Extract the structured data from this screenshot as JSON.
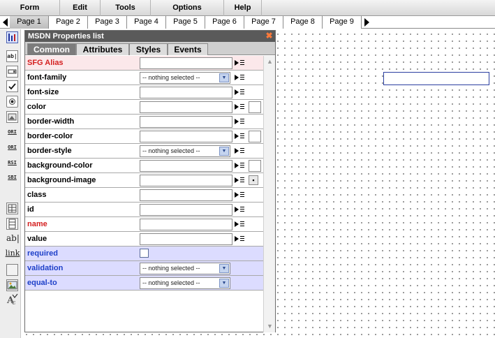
{
  "menu": [
    "Form",
    "Edit",
    "Tools",
    "Options",
    "Help"
  ],
  "page_tabs": [
    "Page 1",
    "Page 2",
    "Page 3",
    "Page 4",
    "Page 5",
    "Page 6",
    "Page 7",
    "Page 8",
    "Page 9"
  ],
  "active_page": "Page 1",
  "toolbar_icons": [
    "form-properties-icon",
    "text-field-icon",
    "list-box-icon",
    "checkbox-icon",
    "radio-icon",
    "label-image-icon",
    "ori-field-1-icon",
    "ori-field-2-icon",
    "rsi-icon",
    "sbi-icon",
    "table-icon",
    "table-alt-icon",
    "label-text-icon",
    "link-icon",
    "frame-icon",
    "image-icon",
    "spell-check-icon"
  ],
  "toolbar_labels": {
    "text_field": "ab|",
    "label": "ab|",
    "link": "link",
    "ori1": "ORI",
    "ori2": "ORI",
    "rsi": "RSI",
    "sbi": "SBI"
  },
  "panel": {
    "title": "MSDN Properties list",
    "tabs": [
      "Common",
      "Attributes",
      "Styles",
      "Events"
    ],
    "active_tab": "Common",
    "select_placeholder": "-- nothing selected --",
    "rows": [
      {
        "label": "SFG Alias",
        "kind": "text",
        "tone": "red"
      },
      {
        "label": "font-family",
        "kind": "select",
        "tone": "normal"
      },
      {
        "label": "font-size",
        "kind": "text",
        "tone": "normal"
      },
      {
        "label": "color",
        "kind": "text-swatch",
        "tone": "normal"
      },
      {
        "label": "border-width",
        "kind": "text",
        "tone": "normal"
      },
      {
        "label": "border-color",
        "kind": "text-swatch",
        "tone": "normal"
      },
      {
        "label": "border-style",
        "kind": "select",
        "tone": "normal"
      },
      {
        "label": "background-color",
        "kind": "text-swatch",
        "tone": "normal"
      },
      {
        "label": "background-image",
        "kind": "text-image",
        "tone": "normal"
      },
      {
        "label": "class",
        "kind": "text",
        "tone": "normal"
      },
      {
        "label": "id",
        "kind": "text",
        "tone": "normal"
      },
      {
        "label": "name",
        "kind": "text",
        "tone": "red"
      },
      {
        "label": "value",
        "kind": "text",
        "tone": "normal"
      },
      {
        "label": "required",
        "kind": "checkbox",
        "tone": "blue"
      },
      {
        "label": "validation",
        "kind": "select-nopick",
        "tone": "blue"
      },
      {
        "label": "equal-to",
        "kind": "select-nopick",
        "tone": "blue"
      }
    ]
  },
  "colors": {
    "panel_title_bg": "#5a5a5a",
    "required_label": "#d42020",
    "validation_label": "#1e40c8",
    "validation_row_bg": "#dcdcff",
    "alias_row_bg": "#fbe8ea",
    "placed_box_border": "#2a3ea0"
  }
}
